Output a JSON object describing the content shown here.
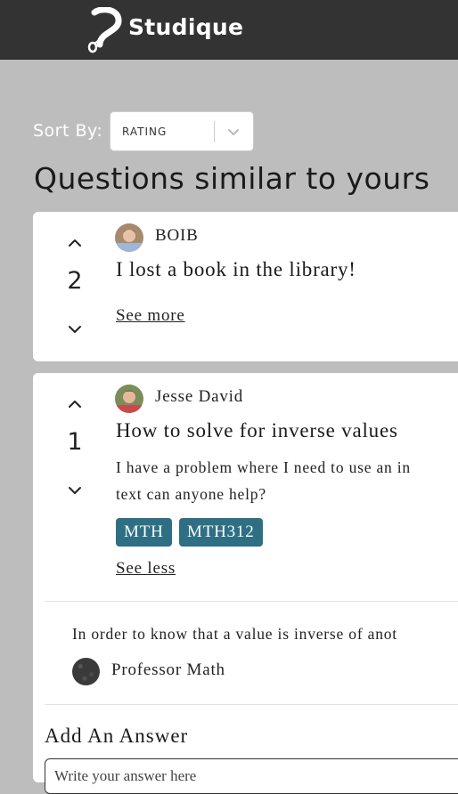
{
  "header": {
    "brand": "Studique",
    "logo_icon": "question-mark-logo-icon",
    "background": "#333333"
  },
  "sort": {
    "label": "Sort By:",
    "selected": "RATING",
    "chevron_icon": "chevron-down-icon"
  },
  "page": {
    "heading": "Questions similar to yours"
  },
  "questions": [
    {
      "votes": "2",
      "author": "BOIB",
      "title": "I lost a book in the library!",
      "toggle": "See more"
    },
    {
      "votes": "1",
      "author": "Jesse David",
      "title": "How to solve for inverse values",
      "body_line1": "I have a problem where I need to use an in",
      "body_line2": "text can anyone help?",
      "tags": [
        "MTH",
        "MTH312"
      ],
      "toggle": "See less",
      "answer": {
        "text": "In order to know that a value is inverse of anot",
        "author": "Professor Math"
      },
      "add_answer": {
        "heading": "Add An Answer",
        "placeholder": "Write your answer here"
      }
    }
  ],
  "colors": {
    "tag": "#2f6f84",
    "page_background": "#bdbdbd"
  }
}
